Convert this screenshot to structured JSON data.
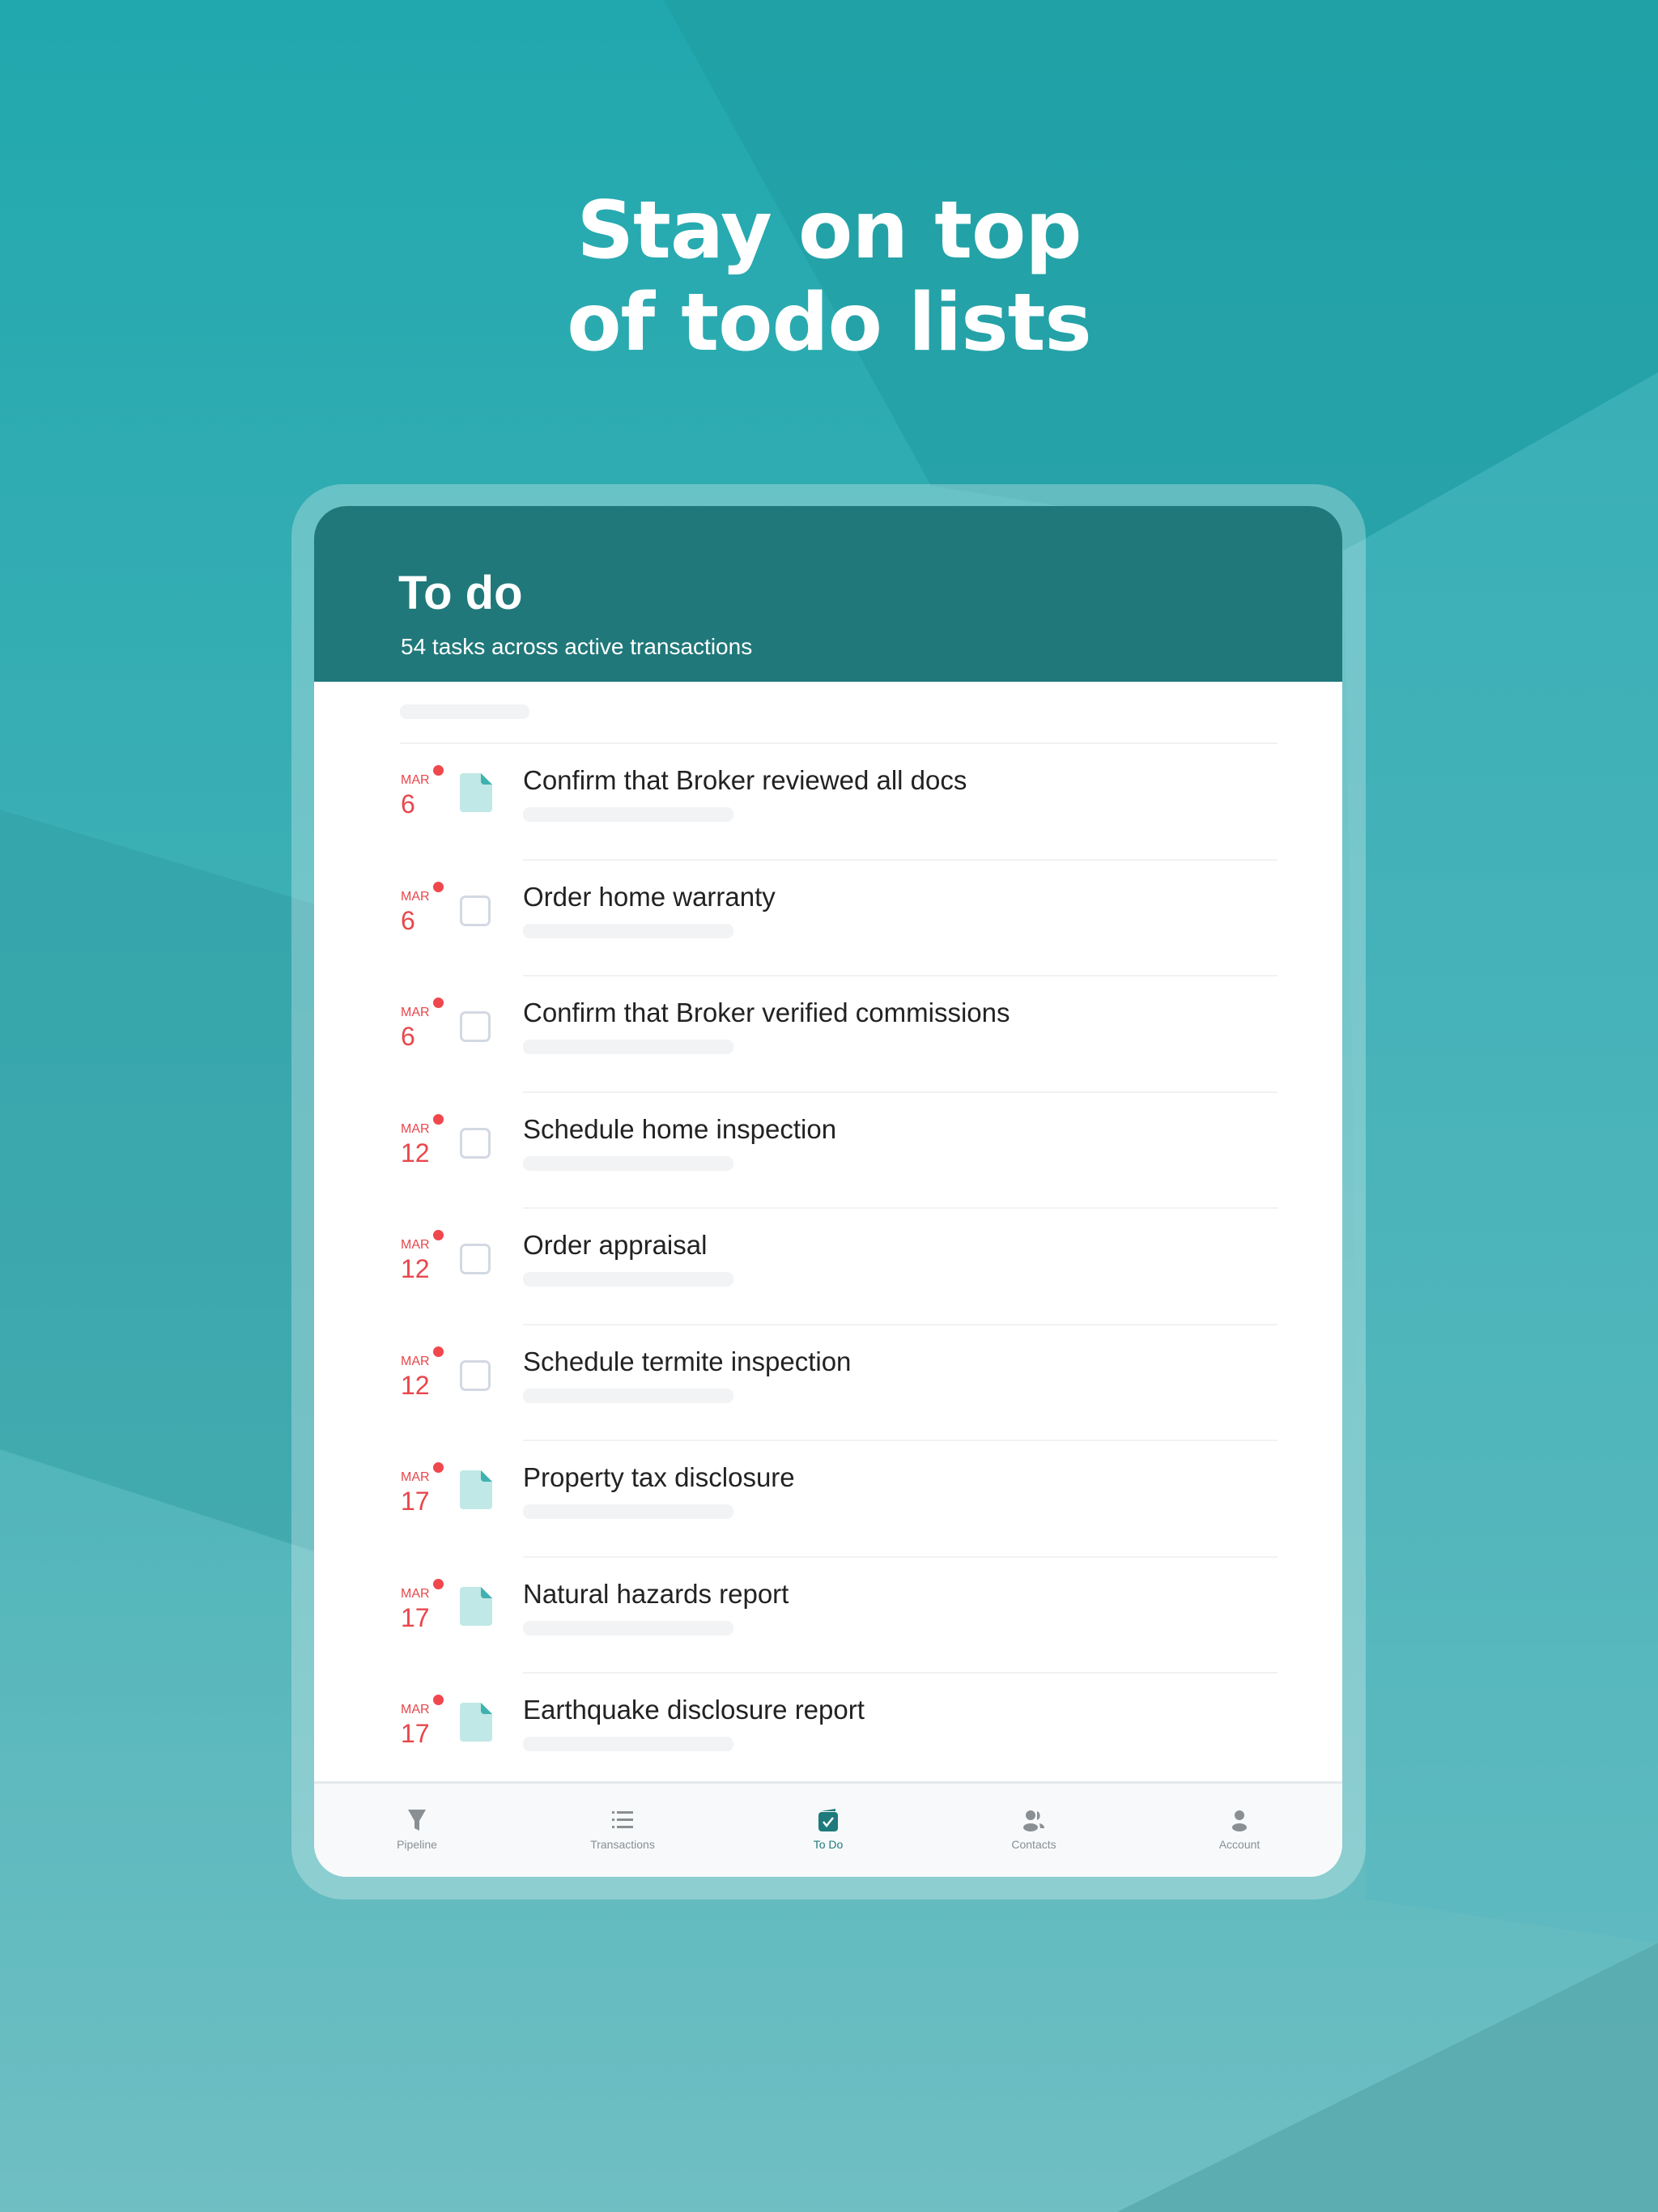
{
  "headline": {
    "line1": "Stay on top",
    "line2": "of todo lists"
  },
  "colors": {
    "header": "#20787a",
    "accent": "#1f7a7c",
    "due": "#e8474c"
  },
  "screen": {
    "title": "To do",
    "subtitle": "54 tasks across active transactions",
    "tasks": [
      {
        "month": "MAR",
        "day": "6",
        "type": "document-icon",
        "label": "Confirm that Broker reviewed all docs"
      },
      {
        "month": "MAR",
        "day": "6",
        "type": "checkbox",
        "label": "Order home warranty"
      },
      {
        "month": "MAR",
        "day": "6",
        "type": "checkbox",
        "label": "Confirm that Broker verified commissions"
      },
      {
        "month": "MAR",
        "day": "12",
        "type": "checkbox",
        "label": "Schedule home inspection"
      },
      {
        "month": "MAR",
        "day": "12",
        "type": "checkbox",
        "label": "Order appraisal"
      },
      {
        "month": "MAR",
        "day": "12",
        "type": "checkbox",
        "label": "Schedule termite inspection"
      },
      {
        "month": "MAR",
        "day": "17",
        "type": "document-icon",
        "label": "Property tax disclosure"
      },
      {
        "month": "MAR",
        "day": "17",
        "type": "document-icon",
        "label": "Natural hazards report"
      },
      {
        "month": "MAR",
        "day": "17",
        "type": "document-icon",
        "label": "Earthquake disclosure report"
      }
    ],
    "tabs": [
      {
        "label": "Pipeline",
        "icon": "funnel-icon"
      },
      {
        "label": "Transactions",
        "icon": "list-icon"
      },
      {
        "label": "To Do",
        "icon": "todo-check-icon",
        "active": true
      },
      {
        "label": "Contacts",
        "icon": "contacts-icon"
      },
      {
        "label": "Account",
        "icon": "person-icon"
      }
    ]
  }
}
